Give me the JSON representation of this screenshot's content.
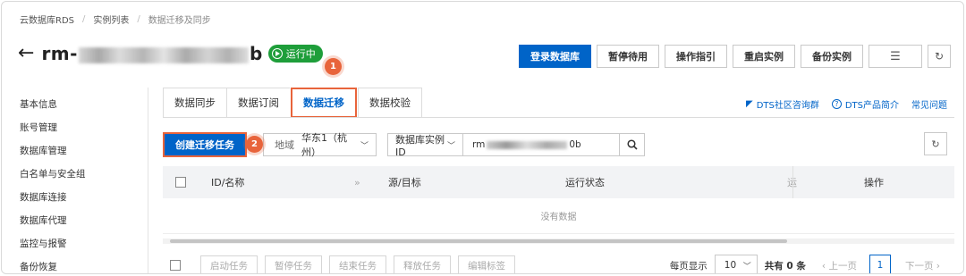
{
  "breadcrumb": [
    "云数据库RDS",
    "实例列表",
    "数据迁移及同步"
  ],
  "instance": {
    "prefix": "rm-",
    "suffix": "b",
    "status": "运行中"
  },
  "markers": [
    "1",
    "2"
  ],
  "top_actions": {
    "login": "登录数据库",
    "pause": "暂停待用",
    "guide": "操作指引",
    "restart": "重启实例",
    "backup": "备份实例",
    "menu_icon": "list-icon",
    "refresh_icon": "refresh-icon"
  },
  "sidebar": {
    "items": [
      "基本信息",
      "账号管理",
      "数据库管理",
      "白名单与安全组",
      "数据库连接",
      "数据库代理",
      "监控与报警",
      "备份恢复"
    ]
  },
  "tabs": [
    {
      "label": "数据同步",
      "active": false
    },
    {
      "label": "数据订阅",
      "active": false
    },
    {
      "label": "数据迁移",
      "active": true
    },
    {
      "label": "数据校验",
      "active": false
    }
  ],
  "links": {
    "community": "DTS社区咨询群",
    "intro": "DTS产品简介",
    "faq": "常见问题"
  },
  "toolbar": {
    "create": "创建迁移任务",
    "region_label": "地域",
    "region_value": "华东1（杭州）",
    "filter_select": "数据库实例ID",
    "filter_value_prefix": "rm",
    "filter_value_suffix": "0b"
  },
  "table": {
    "columns": [
      "ID/名称",
      "源/目标",
      "运行状态",
      "运",
      "操作"
    ],
    "empty_text": "没有数据"
  },
  "footer": {
    "buttons": [
      "启动任务",
      "暂停任务",
      "结束任务",
      "释放任务",
      "编辑标签"
    ],
    "page_size_label": "每页显示",
    "page_size": "10",
    "total": "共有 0 条",
    "prev": "上一页",
    "current_page": "1",
    "next": "下一页"
  },
  "colors": {
    "primary": "#0064c8",
    "accent": "#e8643b",
    "status": "#1e9e3a"
  }
}
